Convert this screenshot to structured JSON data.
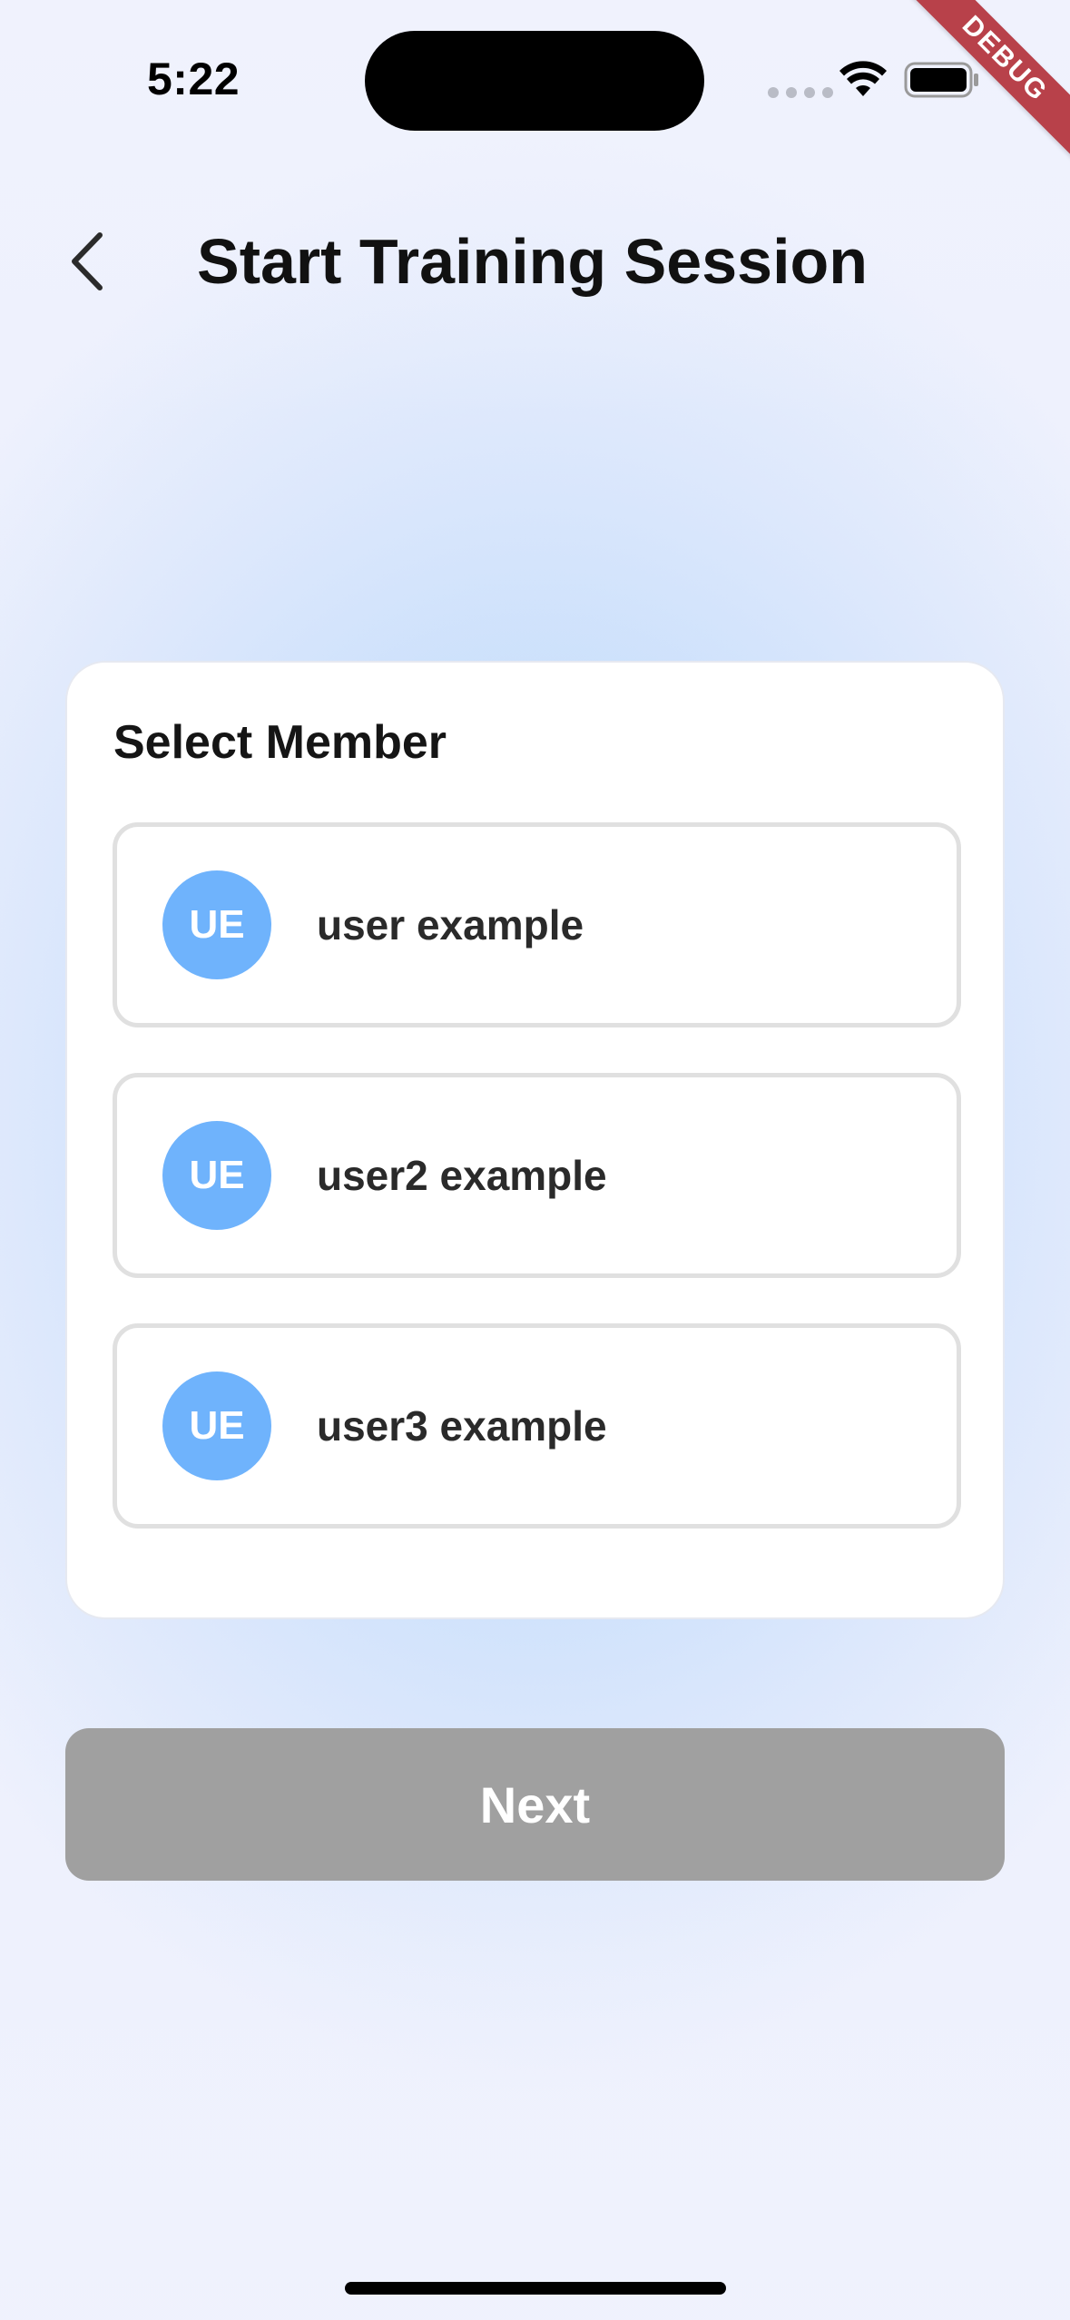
{
  "status_bar": {
    "time": "5:22",
    "icons": [
      "signal-dots-icon",
      "wifi-icon",
      "battery-icon"
    ]
  },
  "debug_banner": "DEBUG",
  "header": {
    "back_icon": "chevron-left-icon",
    "title": "Start Training Session"
  },
  "card": {
    "title": "Select Member",
    "members": [
      {
        "initials": "UE",
        "name": "user example"
      },
      {
        "initials": "UE",
        "name": "user2 example"
      },
      {
        "initials": "UE",
        "name": "user3 example"
      }
    ]
  },
  "next_button": {
    "label": "Next"
  },
  "colors": {
    "avatar": "#6fb3fc",
    "button_disabled": "#a0a0a0",
    "debug_ribbon": "#b8414a",
    "background_center": "#bcd9fb"
  }
}
